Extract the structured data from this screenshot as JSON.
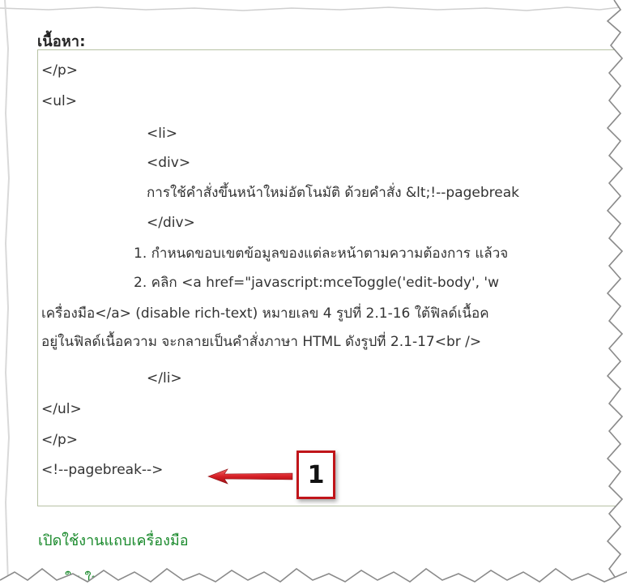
{
  "field": {
    "label": "เนื้อหา:"
  },
  "editor": {
    "lines": [
      "</p>",
      "<ul>",
      "<li>",
      "<div>",
      "การใช้คำสั่งขึ้นหน้าใหม่อัตโนมัติ  ด้วยคำสั่ง &lt;!--pagebreak",
      "</div>",
      "1. กำหนดขอบเขตข้อมูลของแต่ละหน้าตามความต้องการ แล้วจ",
      "2. คลิก <a href=\"javascript:mceToggle('edit-body', 'w",
      "เครื่องมือ</a> (disable rich-text) หมายเลข 4 รูปที่ 2.1-16 ใต้ฟิลด์เนื้อค",
      "อยู่ในฟิลด์เนื้อความ จะกลายเป็นคำสั่งภาษา HTML ดังรูปที่ 2.1-17<br />",
      "</li>",
      "</ul>",
      "</p>",
      "<!--pagebreak-->"
    ]
  },
  "annotation": {
    "callout_number": "1",
    "arrow_color": "#d61f26",
    "box_border_color": "#c0151a"
  },
  "links": {
    "toolbar_toggle": "เปิดใช้งานแถบเครื่องมือ",
    "cut_off_text": "ใบ ใหม"
  },
  "colors": {
    "link_green": "#1a8a2c",
    "editor_border": "#b7c2a4"
  }
}
